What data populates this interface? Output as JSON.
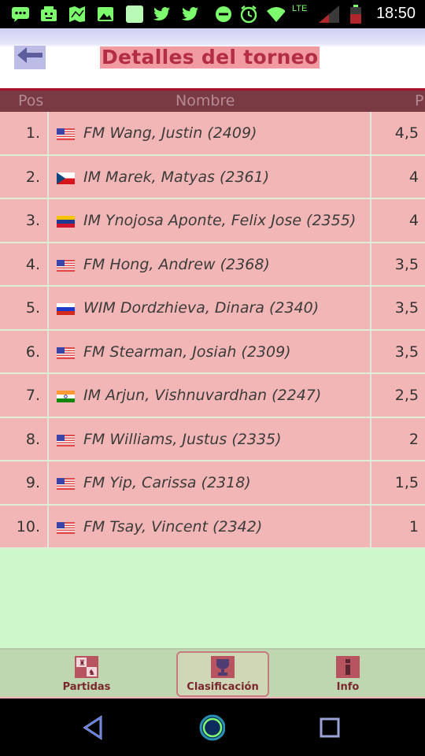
{
  "status_bar": {
    "time": "18:50",
    "network_label": "LTE",
    "icons": [
      "message-icon",
      "game-icon",
      "map-icon",
      "image-icon",
      "app-icon",
      "twitter-icon",
      "twitter-icon",
      "do-not-disturb-icon",
      "alarm-icon",
      "wifi-icon",
      "signal-icon",
      "battery-icon"
    ],
    "icon_color": "#7dfc6e"
  },
  "header": {
    "title": "Detalles del torneo",
    "back_icon": "back-arrow-icon",
    "title_color": "#b32d45",
    "title_bg": "#f19aa2"
  },
  "table": {
    "columns": {
      "pos": "Pos",
      "name": "Nombre",
      "points": "P"
    },
    "header_bg": "#7a3a44",
    "row_bg": "#f3b6b6",
    "rows": [
      {
        "pos": "1.",
        "flag": "usa-flag",
        "name": "FM Wang, Justin (2409)",
        "points": "4,5"
      },
      {
        "pos": "2.",
        "flag": "czech-flag",
        "name": "IM Marek, Matyas (2361)",
        "points": "4"
      },
      {
        "pos": "3.",
        "flag": "venezuela-flag",
        "name": "IM Ynojosa Aponte, Felix Jose (2355)",
        "points": "4"
      },
      {
        "pos": "4.",
        "flag": "usa-flag",
        "name": "FM Hong, Andrew (2368)",
        "points": "3,5"
      },
      {
        "pos": "5.",
        "flag": "russia-flag",
        "name": "WIM Dordzhieva, Dinara (2340)",
        "points": "3,5"
      },
      {
        "pos": "6.",
        "flag": "usa-flag",
        "name": "FM Stearman, Josiah (2309)",
        "points": "3,5"
      },
      {
        "pos": "7.",
        "flag": "india-flag",
        "name": "IM Arjun, Vishnuvardhan (2247)",
        "points": "2,5"
      },
      {
        "pos": "8.",
        "flag": "usa-flag",
        "name": "FM Williams, Justus (2335)",
        "points": "2"
      },
      {
        "pos": "9.",
        "flag": "usa-flag",
        "name": "FM Yip, Carissa (2318)",
        "points": "1,5"
      },
      {
        "pos": "10.",
        "flag": "usa-flag",
        "name": "FM Tsay, Vincent (2342)",
        "points": "1"
      }
    ]
  },
  "tabs": [
    {
      "label": "Partidas",
      "icon": "chessboard-icon",
      "selected": false
    },
    {
      "label": "Clasificación",
      "icon": "trophy-icon",
      "selected": true
    },
    {
      "label": "Info",
      "icon": "info-icon",
      "selected": false
    }
  ],
  "nav_bar": {
    "icons": [
      "back-triangle-icon",
      "home-circle-icon",
      "recents-square-icon"
    ],
    "color": "#0b40ff"
  }
}
